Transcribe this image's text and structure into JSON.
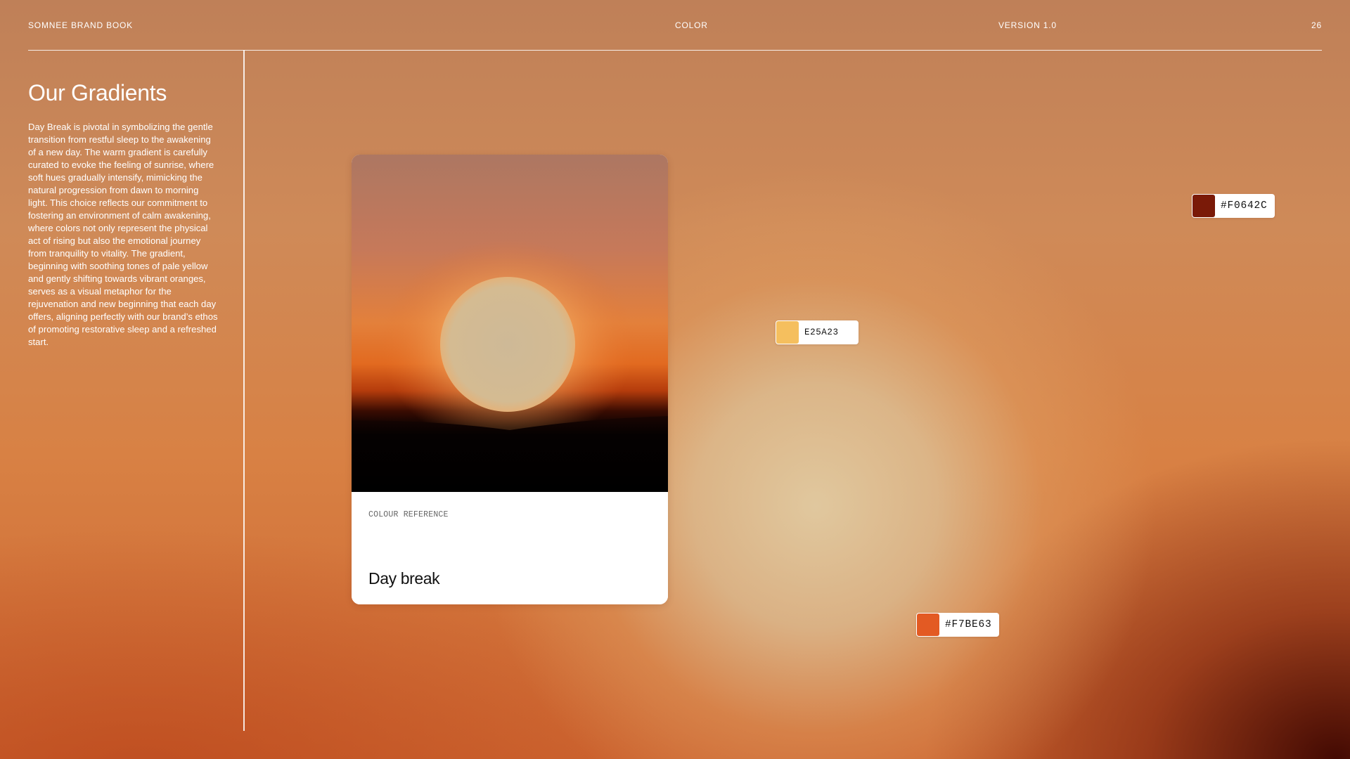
{
  "header": {
    "brand": "SOMNEE BRAND BOOK",
    "section": "COLOR",
    "version": "VERSION 1.0",
    "page_number": "26"
  },
  "intro": {
    "title": "Our Gradients",
    "body": "Day Break is pivotal in symbolizing the gentle transition from restful sleep to the awakening of a new day. The warm gradient is carefully curated to evoke the feeling of sunrise, where soft hues gradually intensify, mimicking the natural progression from dawn to morning light. This choice reflects our commitment to fostering an environment of calm awakening, where colors not only represent the physical act of rising but also the emotional journey from tranquility to vitality. The gradient, beginning with soothing tones of pale yellow and gently shifting towards vibrant oranges, serves as a visual metaphor for the rejuvenation and new beginning that each day offers, aligning perfectly with our brand’s ethos of promoting restorative sleep and a refreshed start."
  },
  "reference_card": {
    "label": "COLOUR REFERENCE",
    "title": "Day break",
    "image_icon": "sunset-photo"
  },
  "swatches": [
    {
      "code": "#F0642C",
      "color": "#7a1a08"
    },
    {
      "code": "E25A23",
      "color": "#f5bf5e"
    },
    {
      "code": "#F7BE63",
      "color": "#e35a23"
    }
  ]
}
